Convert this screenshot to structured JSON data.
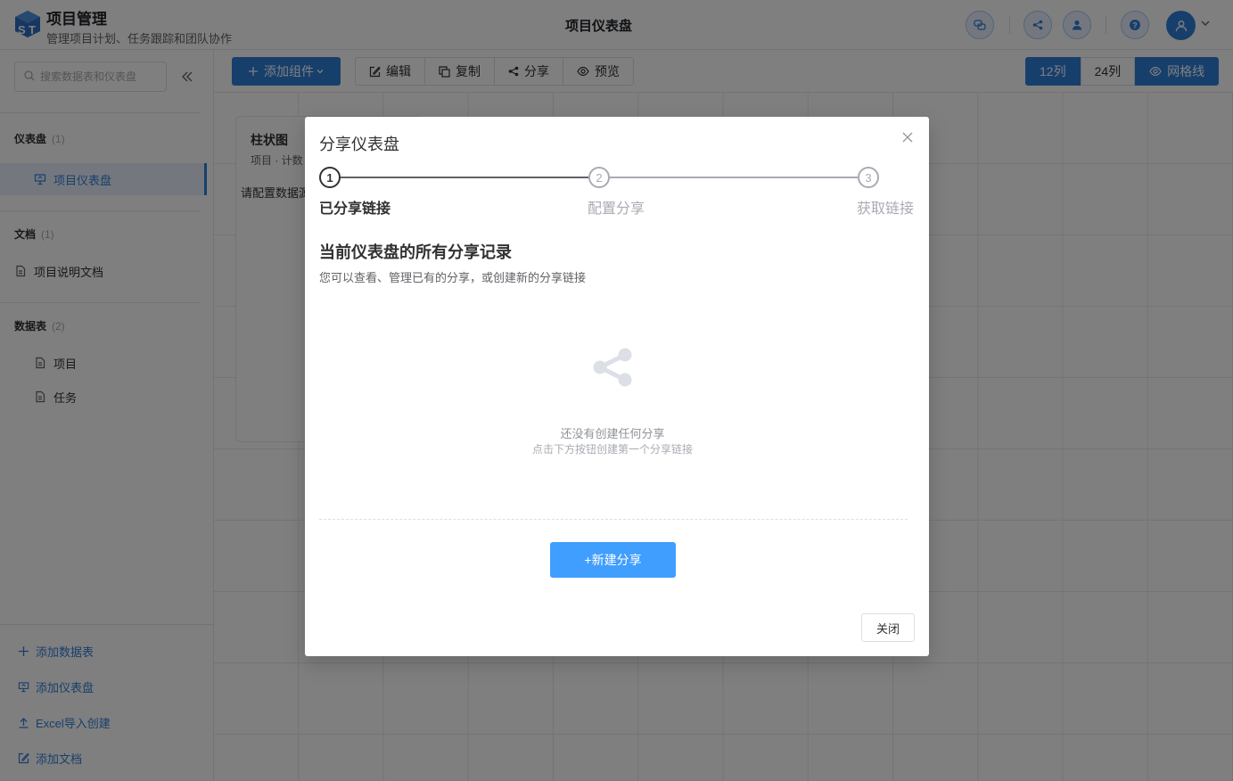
{
  "header": {
    "app_title": "项目管理",
    "app_subtitle": "管理项目计划、任务跟踪和团队协作",
    "page_title": "项目仪表盘"
  },
  "sidebar": {
    "search_placeholder": "搜索数据表和仪表盘",
    "sections": {
      "dashboards": {
        "title": "仪表盘",
        "count": "(1)",
        "items": [
          "项目仪表盘"
        ]
      },
      "documents": {
        "title": "文档",
        "count": "(1)",
        "items": [
          "项目说明文档"
        ]
      },
      "tables": {
        "title": "数据表",
        "count": "(2)",
        "items": [
          "项目",
          "任务"
        ]
      }
    },
    "actions": [
      "添加数据表",
      "添加仪表盘",
      "Excel导入创建",
      "添加文档"
    ]
  },
  "toolbar": {
    "add_widget": "添加组件",
    "edit": "编辑",
    "copy": "复制",
    "share": "分享",
    "preview": "预览",
    "cols_12": "12列",
    "cols_24": "24列",
    "gridlines": "网格线"
  },
  "widget": {
    "title": "柱状图",
    "subtitle": "项目 · 计数",
    "body": "请配置数据源"
  },
  "modal": {
    "title": "分享仪表盘",
    "steps": [
      {
        "num": "1",
        "label": "已分享链接"
      },
      {
        "num": "2",
        "label": "配置分享"
      },
      {
        "num": "3",
        "label": "获取链接"
      }
    ],
    "heading": "当前仪表盘的所有分享记录",
    "description": "您可以查看、管理已有的分享，或创建新的分享链接",
    "empty_title": "还没有创建任何分享",
    "empty_hint": "点击下方按钮创建第一个分享链接",
    "new_share": "+新建分享",
    "close": "关闭"
  },
  "colors": {
    "primary": "#2f7fd8",
    "modal_button": "#409eff"
  }
}
